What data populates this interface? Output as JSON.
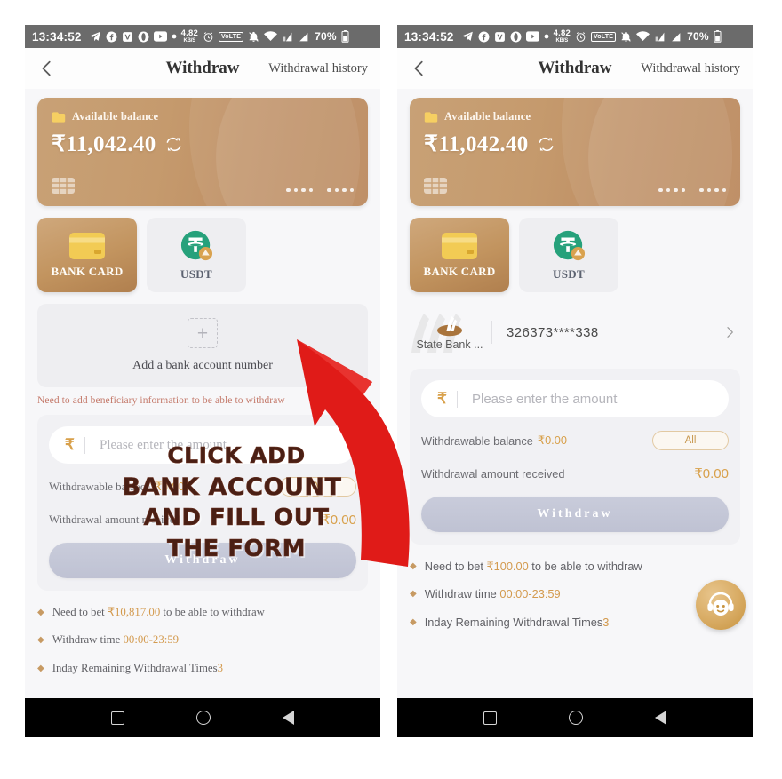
{
  "status_bar": {
    "time": "13:34:52",
    "net_speed_value": "4.82",
    "net_speed_unit": "KB/S",
    "volte_label": "VoLTE",
    "battery": "70%",
    "icons": [
      "telegram-icon",
      "facebook-icon",
      "v-app-icon",
      "opera-icon",
      "youtube-icon",
      "dot-icon",
      "alarm-icon",
      "volte-icon",
      "mute-icon",
      "wifi-icon",
      "signal-1-icon",
      "signal-2-icon"
    ]
  },
  "appbar": {
    "title": "Withdraw",
    "action": "Withdrawal history",
    "back_icon": "back-chevron-icon"
  },
  "balance_card": {
    "label": "Available balance",
    "amount": "₹11,042.40",
    "wallet_icon": "wallet-icon",
    "refresh_icon": "refresh-icon",
    "gradient_from": "#c8a176",
    "gradient_to": "#b98659"
  },
  "methods": [
    {
      "label": "BANK CARD",
      "icon": "bank-card-icon",
      "active": true
    },
    {
      "label": "USDT",
      "icon": "usdt-icon",
      "active": false
    }
  ],
  "left_panel": {
    "add_bank": {
      "plus_icon": "plus-icon",
      "text": "Add a bank account number"
    },
    "warning": "Need to add beneficiary information to be able to withdraw",
    "form": {
      "currency_symbol": "₹",
      "amount_placeholder": "Please enter the amount",
      "amount_value": "",
      "withdrawable_label": "Withdrawable balance",
      "withdrawable_value": "₹0.00",
      "all_button": "All",
      "received_label": "Withdrawal amount received",
      "received_value": "₹0.00"
    },
    "withdraw_button": "Withdraw",
    "notes": [
      {
        "prefix": "Need to bet ",
        "highlight": "₹10,817.00",
        "suffix": " to be able to withdraw"
      },
      {
        "prefix": "Withdraw time ",
        "highlight": "00:00-23:59",
        "suffix": ""
      },
      {
        "prefix": "Inday Remaining Withdrawal Times",
        "highlight": "3",
        "suffix": ""
      }
    ]
  },
  "right_panel": {
    "bank_row": {
      "bank_name": "State Bank ...",
      "account_number": "326373****338",
      "bank_icon": "sbi-flame-icon",
      "chevron_icon": "chevron-right-icon"
    },
    "form": {
      "currency_symbol": "₹",
      "amount_placeholder": "Please enter the amount",
      "amount_value": "",
      "withdrawable_label": "Withdrawable balance",
      "withdrawable_value": "₹0.00",
      "all_button": "All",
      "received_label": "Withdrawal amount received",
      "received_value": "₹0.00"
    },
    "withdraw_button": "Withdraw",
    "notes": [
      {
        "prefix": "Need to bet ",
        "highlight": "₹100.00",
        "suffix": " to be able to withdraw"
      },
      {
        "prefix": "Withdraw time ",
        "highlight": "00:00-23:59",
        "suffix": ""
      },
      {
        "prefix": "Inday Remaining Withdrawal Times",
        "highlight": "3",
        "suffix": ""
      }
    ],
    "support_fab_icon": "headset-support-icon"
  },
  "annotation": {
    "arrow_color": "#e01b18",
    "caption_lines": [
      "CLICK ADD",
      "BANK ACCOUNT",
      "AND FILL OUT",
      "THE FORM"
    ]
  },
  "nav_bar": {
    "recent_icon": "square-recents-icon",
    "home_icon": "circle-home-icon",
    "back_icon": "triangle-back-icon"
  }
}
